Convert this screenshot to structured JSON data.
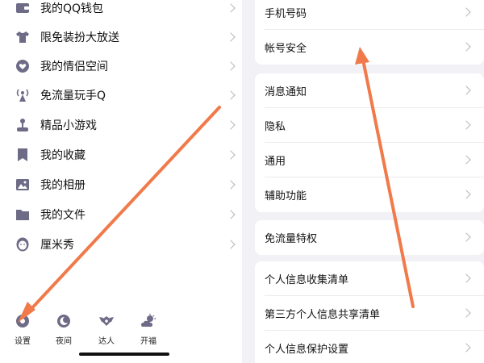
{
  "left_menu": {
    "items": [
      {
        "label": "我的QQ钱包",
        "icon": "wallet-icon"
      },
      {
        "label": "限免装扮大放送",
        "icon": "tshirt-icon"
      },
      {
        "label": "我的情侣空间",
        "icon": "heart-icon"
      },
      {
        "label": "免流量玩手Q",
        "icon": "signal-tower-icon"
      },
      {
        "label": "精品小游戏",
        "icon": "joystick-icon"
      },
      {
        "label": "我的收藏",
        "icon": "bookmark-icon"
      },
      {
        "label": "我的相册",
        "icon": "image-icon"
      },
      {
        "label": "我的文件",
        "icon": "folder-icon"
      },
      {
        "label": "厘米秀",
        "icon": "avatar-face-icon"
      }
    ]
  },
  "bottom_bar": {
    "settings": "设置",
    "night": "夜间",
    "expert": "达人",
    "kaifu": "开福"
  },
  "settings": {
    "group1": [
      "手机号码",
      "帐号安全"
    ],
    "group2": [
      "消息通知",
      "隐私",
      "通用",
      "辅助功能"
    ],
    "group3": [
      "免流量特权"
    ],
    "group4": [
      "个人信息收集清单",
      "第三方个人信息共享清单",
      "个人信息保护设置"
    ]
  },
  "colors": {
    "icon": "#6e6b87",
    "annotation_arrow": "#f07a4a",
    "panel_bg": "#f1f1f6"
  }
}
